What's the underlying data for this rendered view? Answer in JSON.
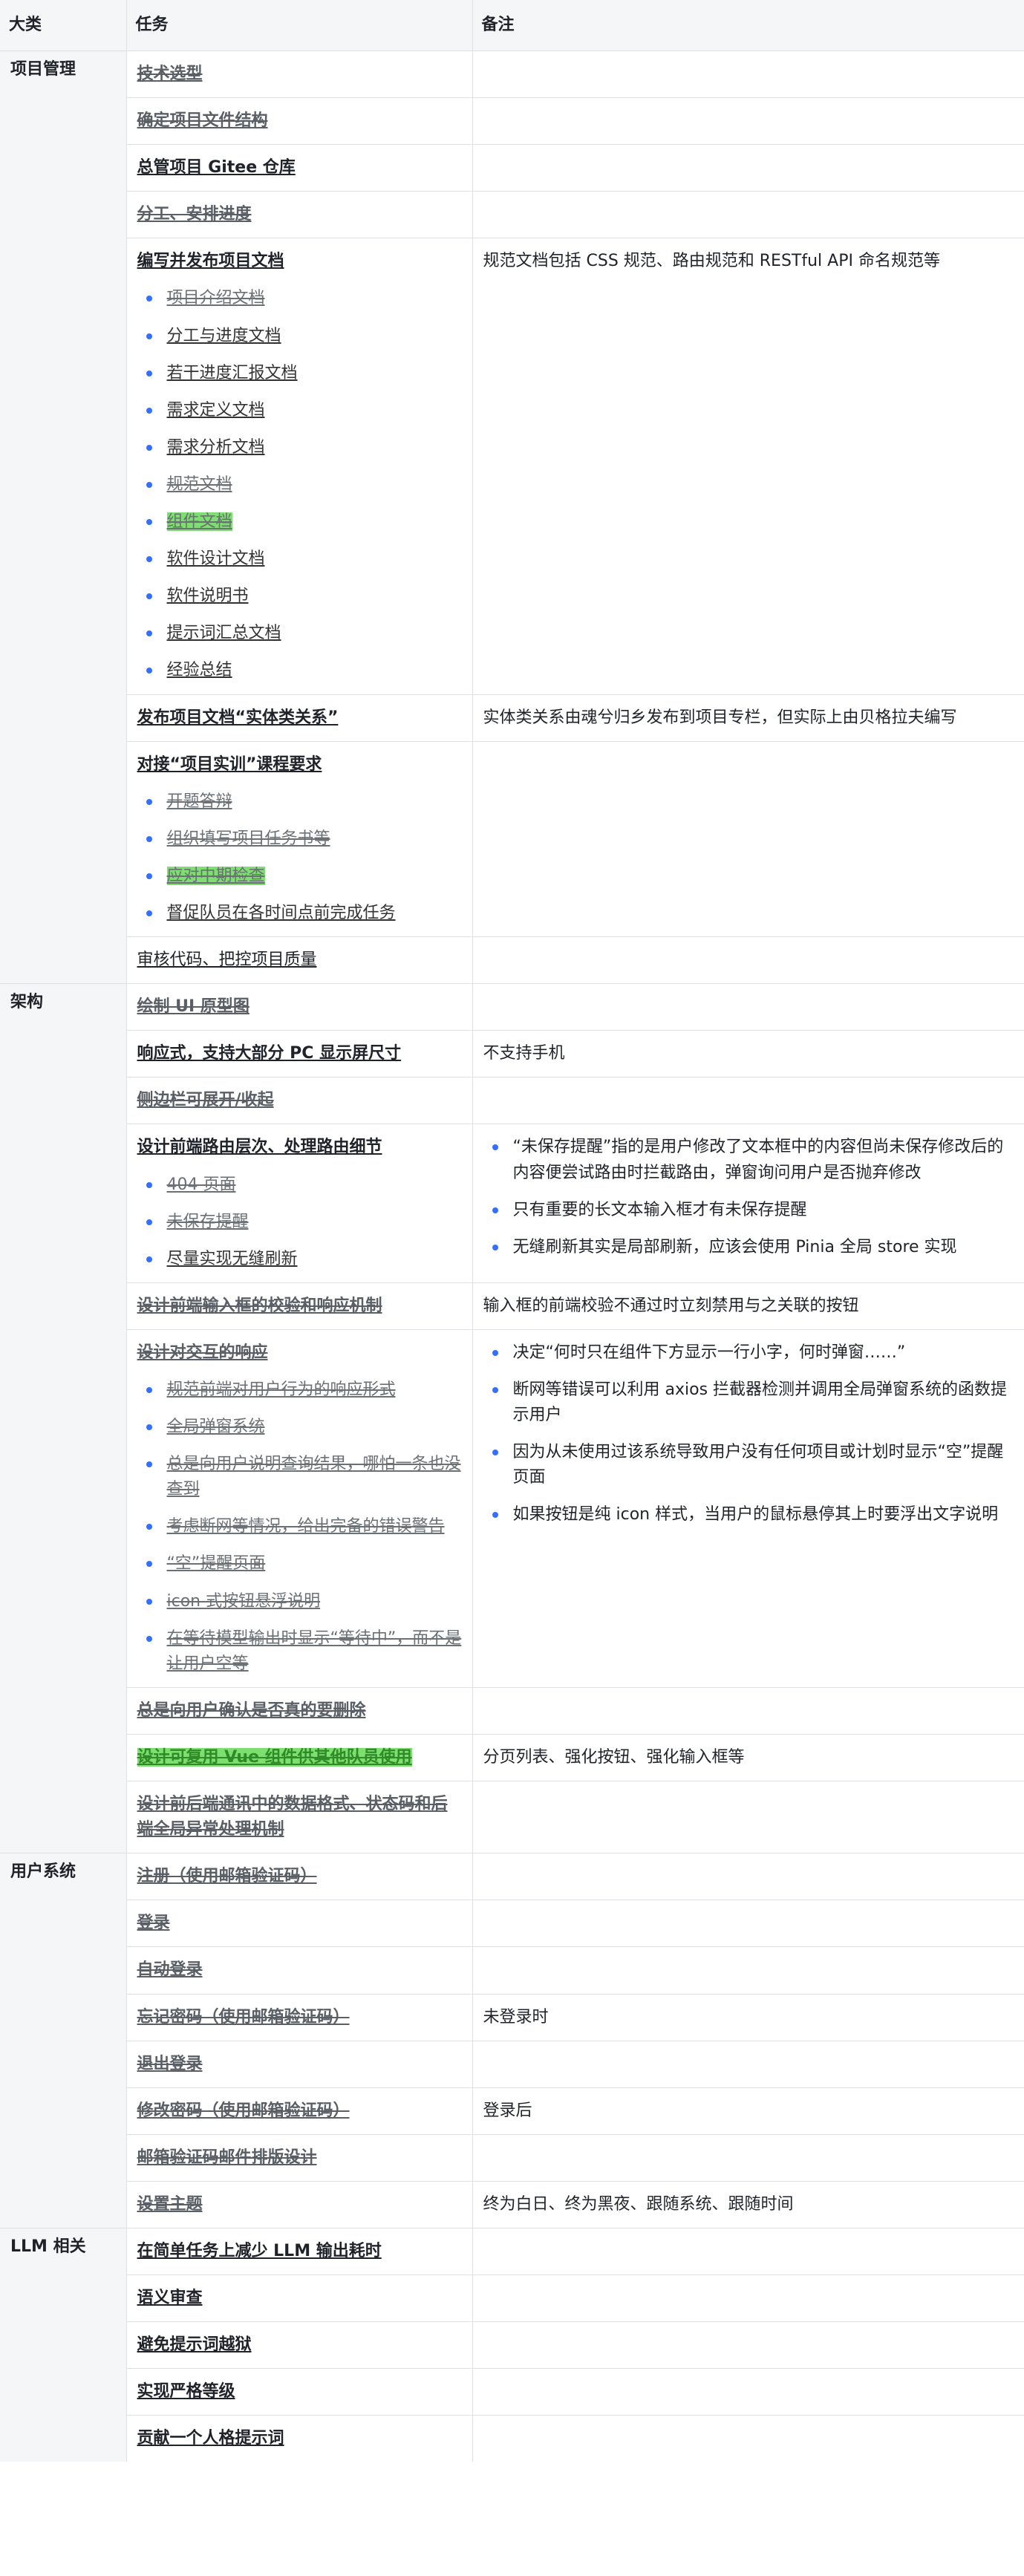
{
  "headers": [
    "大类",
    "任务",
    "备注"
  ],
  "groups": [
    {
      "category": "项目管理",
      "rows": [
        {
          "title": "技术选型",
          "done": true
        },
        {
          "title": "确定项目文件结构",
          "done": true
        },
        {
          "title": "总管项目 Gitee 仓库",
          "done": false
        },
        {
          "title": "分工、安排进度",
          "done": true
        },
        {
          "title": "编写并发布项目文档",
          "done": false,
          "subs": [
            {
              "text": "项目介绍文档",
              "done": true
            },
            {
              "text": "分工与进度文档",
              "done": false
            },
            {
              "text": "若干进度汇报文档",
              "done": false
            },
            {
              "text": "需求定义文档",
              "done": false
            },
            {
              "text": "需求分析文档",
              "done": false
            },
            {
              "text": "规范文档",
              "done": true
            },
            {
              "text": "组件文档",
              "done": true,
              "highlight": true
            },
            {
              "text": "软件设计文档",
              "done": false
            },
            {
              "text": "软件说明书",
              "done": false
            },
            {
              "text": "提示词汇总文档",
              "done": false
            },
            {
              "text": "经验总结",
              "done": false
            }
          ],
          "note": "规范文档包括 CSS 规范、路由规范和 RESTful API 命名规范等"
        },
        {
          "title": "发布项目文档“实体类关系”",
          "done": false,
          "note": "实体类关系由魂兮归乡发布到项目专栏，但实际上由贝格拉夫编写"
        },
        {
          "title": "对接“项目实训”课程要求",
          "done": false,
          "subs": [
            {
              "text": "开题答辩",
              "done": true
            },
            {
              "text": "组织填写项目任务书等",
              "done": true
            },
            {
              "text": "应对中期检查",
              "done": true,
              "highlight": true
            },
            {
              "text": "督促队员在各时间点前完成任务",
              "done": false
            }
          ]
        },
        {
          "title": "审核代码、把控项目质量",
          "done": false,
          "plain": true
        }
      ]
    },
    {
      "category": "架构",
      "rows": [
        {
          "title": "绘制 UI 原型图",
          "done": true
        },
        {
          "title": "响应式，支持大部分 PC 显示屏尺寸",
          "done": false,
          "note": "不支持手机"
        },
        {
          "title": "侧边栏可展开/收起",
          "done": true
        },
        {
          "title": "设计前端路由层次、处理路由细节",
          "done": false,
          "subs": [
            {
              "text": "404 页面",
              "done": true
            },
            {
              "text": "未保存提醒",
              "done": true
            },
            {
              "text": "尽量实现无缝刷新",
              "done": false
            }
          ],
          "notes": [
            "“未保存提醒”指的是用户修改了文本框中的内容但尚未保存修改后的内容便尝试路由时拦截路由，弹窗询问用户是否抛弃修改",
            "只有重要的长文本输入框才有未保存提醒",
            "无缝刷新其实是局部刷新，应该会使用 Pinia 全局 store 实现"
          ]
        },
        {
          "title": "设计前端输入框的校验和响应机制",
          "done": true,
          "note": "输入框的前端校验不通过时立刻禁用与之关联的按钮"
        },
        {
          "title": "设计对交互的响应",
          "done": true,
          "subs": [
            {
              "text": "规范前端对用户行为的响应形式",
              "done": true
            },
            {
              "text": "全局弹窗系统",
              "done": true
            },
            {
              "text": "总是向用户说明查询结果，哪怕一条也没查到",
              "done": true
            },
            {
              "text": "考虑断网等情况，给出完备的错误警告",
              "done": true
            },
            {
              "text": "“空”提醒页面",
              "done": true
            },
            {
              "text": "icon 式按钮悬浮说明",
              "done": true
            },
            {
              "text": "在等待模型输出时显示“等待中”，而不是让用户空等",
              "done": true
            }
          ],
          "notes": [
            "决定“何时只在组件下方显示一行小字，何时弹窗……”",
            "断网等错误可以利用 axios 拦截器检测并调用全局弹窗系统的函数提示用户",
            "因为从未使用过该系统导致用户没有任何项目或计划时显示“空”提醒页面",
            "如果按钮是纯 icon 样式，当用户的鼠标悬停其上时要浮出文字说明"
          ]
        },
        {
          "title": "总是向用户确认是否真的要删除",
          "done": true
        },
        {
          "title": "设计可复用 Vue 组件供其他队员使用",
          "done": true,
          "highlight": true,
          "note": "分页列表、强化按钮、强化输入框等"
        },
        {
          "title": "设计前后端通讯中的数据格式、状态码和后端全局异常处理机制",
          "done": true
        }
      ]
    },
    {
      "category": "用户系统",
      "rows": [
        {
          "title": "注册（使用邮箱验证码）",
          "done": true
        },
        {
          "title": "登录",
          "done": true
        },
        {
          "title": "自动登录",
          "done": true
        },
        {
          "title": "忘记密码（使用邮箱验证码）",
          "done": true,
          "note": "未登录时"
        },
        {
          "title": "退出登录",
          "done": true
        },
        {
          "title": "修改密码（使用邮箱验证码）",
          "done": true,
          "note": "登录后"
        },
        {
          "title": "邮箱验证码邮件排版设计",
          "done": true
        },
        {
          "title": "设置主题",
          "done": true,
          "note": "终为白日、终为黑夜、跟随系统、跟随时间"
        }
      ]
    },
    {
      "category": "LLM 相关",
      "rows": [
        {
          "title": "在简单任务上减少 LLM 输出耗时",
          "done": false
        },
        {
          "title": "语义审查",
          "done": false
        },
        {
          "title": "避免提示词越狱",
          "done": false
        },
        {
          "title": "实现严格等级",
          "done": false
        },
        {
          "title": "贡献一个人格提示词",
          "done": false
        }
      ]
    }
  ]
}
